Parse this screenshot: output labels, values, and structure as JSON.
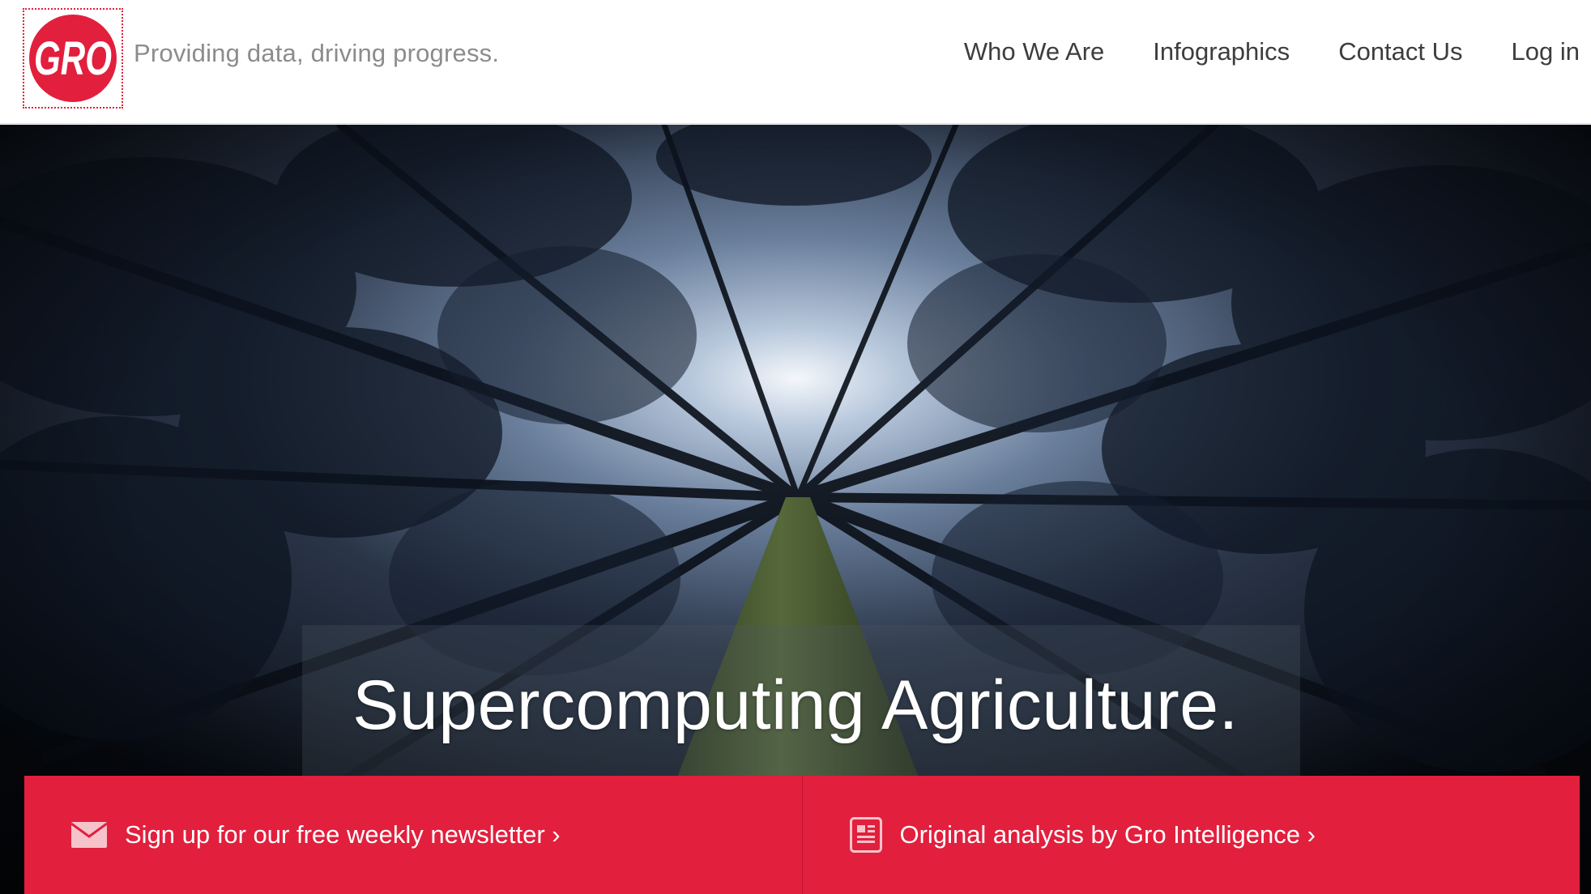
{
  "header": {
    "logo_text": "GRO",
    "tagline": "Providing data, driving progress.",
    "nav": [
      {
        "label": "Who We Are"
      },
      {
        "label": "Infographics"
      },
      {
        "label": "Contact Us"
      },
      {
        "label": "Log in"
      }
    ]
  },
  "hero": {
    "title": "Supercomputing Agriculture."
  },
  "cta": {
    "newsletter": {
      "label": "Sign up for our free weekly newsletter ›",
      "icon": "envelope-icon"
    },
    "analysis": {
      "label": "Original analysis by Gro Intelligence ›",
      "icon": "document-icon"
    }
  },
  "colors": {
    "brand_red": "#e21f3d",
    "nav_text": "#3d3d3d",
    "tagline_text": "#8c8c8c"
  }
}
